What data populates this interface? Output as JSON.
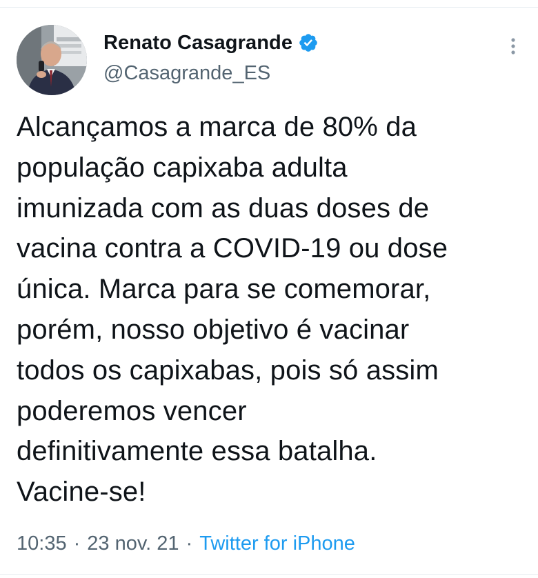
{
  "author": {
    "display_name": "Renato Casagrande",
    "handle": "@Casagrande_ES",
    "verified": true,
    "avatar_icon": "profile-photo",
    "verified_icon": "verified-badge-icon"
  },
  "tweet": {
    "text": "Alcançamos a marca de 80% da\npopulação capixaba adulta\nimunizada com as duas doses de\nvacina contra a COVID-19 ou dose\núnica. Marca para se comemorar,\nporém, nosso objetivo é vacinar\ntodos os capixabas, pois só assim\npoderemos vencer\ndefinitivamente essa batalha.\nVacine-se!",
    "time": "10:35",
    "date": "23 nov. 21",
    "separator": "·",
    "source": "Twitter for iPhone"
  },
  "colors": {
    "text": "#0f1419",
    "secondary": "#536471",
    "accent": "#1d9bf0"
  },
  "more_icon": "more-vertical-icon"
}
